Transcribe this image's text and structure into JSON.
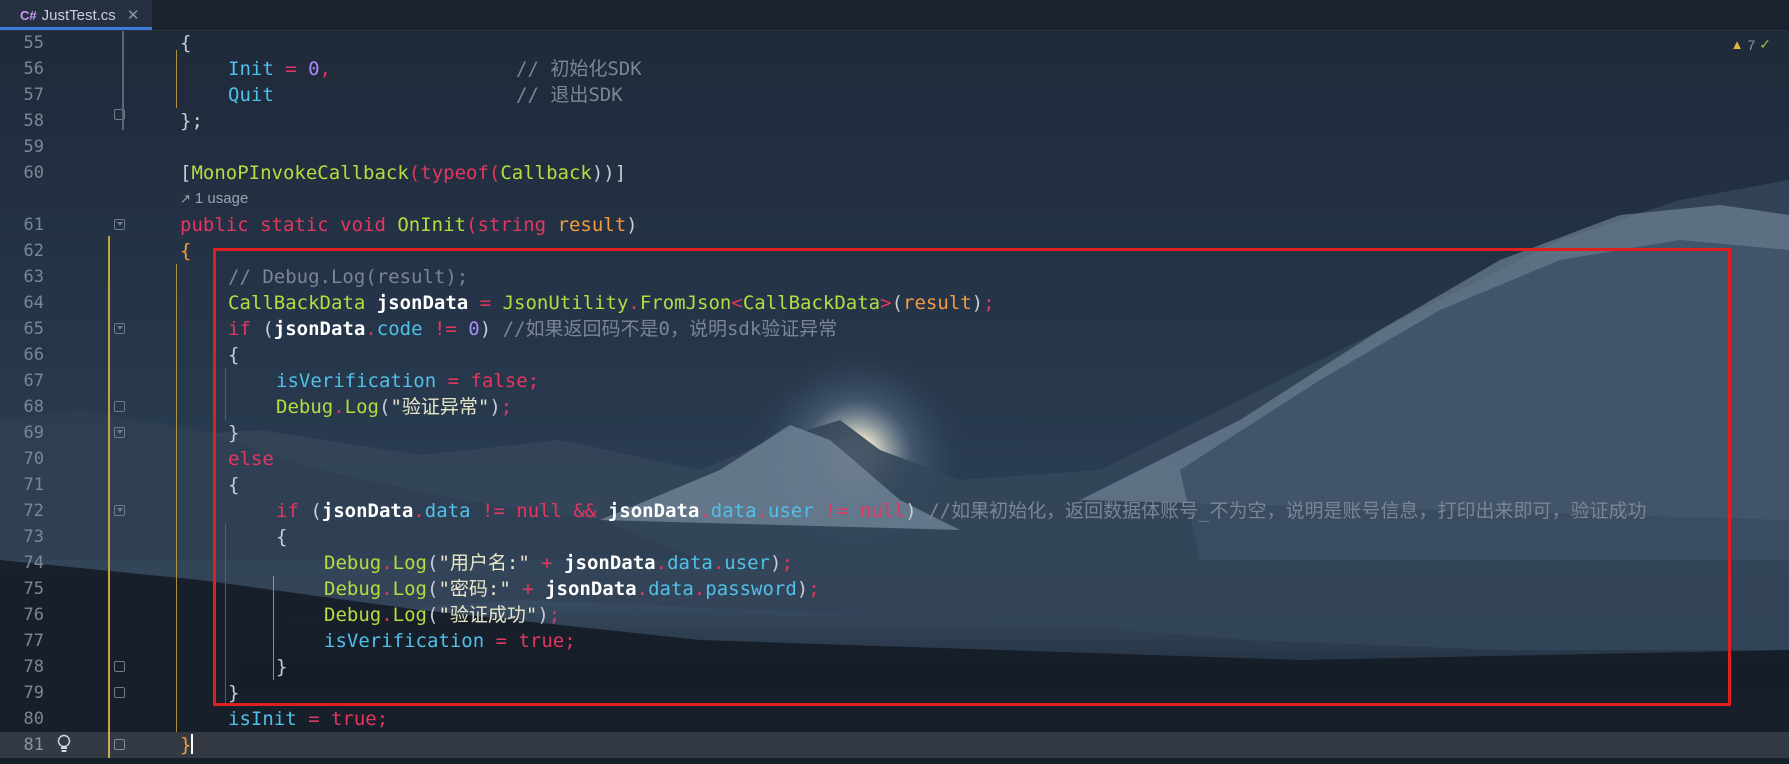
{
  "tab": {
    "icon_label": "C#",
    "filename": "JustTest.cs",
    "close_glyph": "✕"
  },
  "inspections": {
    "warning_count": "7",
    "warning_icon": "warning-triangle-icon",
    "ok_icon": "checkmark-icon"
  },
  "hint": {
    "text": "1 usage",
    "icon": "arrow-up-right-icon"
  },
  "line_numbers": [
    "55",
    "56",
    "57",
    "58",
    "59",
    "60",
    "61",
    "62",
    "63",
    "64",
    "65",
    "66",
    "67",
    "68",
    "69",
    "70",
    "71",
    "72",
    "73",
    "74",
    "75",
    "76",
    "77",
    "78",
    "79",
    "80",
    "81"
  ],
  "code": {
    "l55_brace": "{",
    "l56_name": "Init",
    "l56_eq": " = ",
    "l56_val": "0",
    "l56_comma": ",",
    "l56_comment": "// 初始化SDK",
    "l57_name": "Quit",
    "l57_comment": "// 退出SDK",
    "l58_brace": "};",
    "l60_open": "[",
    "l60_attr": "MonoPInvokeCallback",
    "l60_p1": "(",
    "l60_typeof": "typeof",
    "l60_p2": "(",
    "l60_type": "Callback",
    "l60_close": "))]",
    "l61_kw": "public static void ",
    "l61_fn": "OnInit",
    "l61_p1": "(",
    "l61_type": "string ",
    "l61_param": "result",
    "l61_p2": ")",
    "l62_brace": "{",
    "l63_comment": "// Debug.Log(result);",
    "l64_type": "CallBackData ",
    "l64_var": "jsonData",
    "l64_eq": " = ",
    "l64_cls": "JsonUtility",
    "l64_dot": ".",
    "l64_fn": "FromJson",
    "l64_lt": "<",
    "l64_gen": "CallBackData",
    "l64_gt": ">",
    "l64_p1": "(",
    "l64_param": "result",
    "l64_p2": ")",
    "l64_semi": ";",
    "l65_if": "if",
    "l65_p1": " (",
    "l65_var": "jsonData",
    "l65_dot": ".",
    "l65_prop": "code",
    "l65_op": " != ",
    "l65_num": "0",
    "l65_p2": ") ",
    "l65_comment": "//如果返回码不是0，说明sdk验证异常",
    "l66_brace": "{",
    "l67_field": "isVerification",
    "l67_eq": " = ",
    "l67_val": "false",
    "l67_semi": ";",
    "l68_cls": "Debug",
    "l68_dot": ".",
    "l68_fn": "Log",
    "l68_p1": "(",
    "l68_str": "\"验证异常\"",
    "l68_p2": ")",
    "l68_semi": ";",
    "l69_brace": "}",
    "l70_else": "else",
    "l71_brace": "{",
    "l72_if": "if",
    "l72_p1": " (",
    "l72_var1": "jsonData",
    "l72_dot1": ".",
    "l72_prop1": "data",
    "l72_op1": " != ",
    "l72_null1": "null",
    "l72_and": " && ",
    "l72_var2": "jsonData",
    "l72_dot2": ".",
    "l72_prop2": "data",
    "l72_dot3": ".",
    "l72_prop3": "user",
    "l72_op2": " != ",
    "l72_null2": "null",
    "l72_p2": ") ",
    "l72_comment": "//如果初始化，返回数据体账号_不为空，说明是账号信息，打印出来即可，验证成功",
    "l73_brace": "{",
    "l74_cls": "Debug",
    "l74_dot": ".",
    "l74_fn": "Log",
    "l74_p1": "(",
    "l74_str": "\"用户名:\"",
    "l74_plus": " + ",
    "l74_var": "jsonData",
    "l74_dot2": ".",
    "l74_prop1": "data",
    "l74_dot3": ".",
    "l74_prop2": "user",
    "l74_p2": ")",
    "l74_semi": ";",
    "l75_cls": "Debug",
    "l75_dot": ".",
    "l75_fn": "Log",
    "l75_p1": "(",
    "l75_str": "\"密码:\"",
    "l75_plus": " + ",
    "l75_var": "jsonData",
    "l75_dot2": ".",
    "l75_prop1": "data",
    "l75_dot3": ".",
    "l75_prop2": "password",
    "l75_p2": ")",
    "l75_semi": ";",
    "l76_cls": "Debug",
    "l76_dot": ".",
    "l76_fn": "Log",
    "l76_p1": "(",
    "l76_str": "\"验证成功\"",
    "l76_p2": ")",
    "l76_semi": ";",
    "l77_field": "isVerification",
    "l77_eq": " = ",
    "l77_val": "true",
    "l77_semi": ";",
    "l78_brace": "}",
    "l79_brace": "}",
    "l80_field": "isInit",
    "l80_eq": " = ",
    "l80_val": "true",
    "l80_semi": ";",
    "l81_brace": "}"
  },
  "colors": {
    "keyword": "#e4365f",
    "type": "#b5dd3e",
    "field": "#4fc1e9",
    "number": "#a88cf5",
    "string": "#e9e7c8",
    "comment": "#7b8593",
    "parameter": "#f39c3d",
    "highlight_box": "#e02020"
  }
}
